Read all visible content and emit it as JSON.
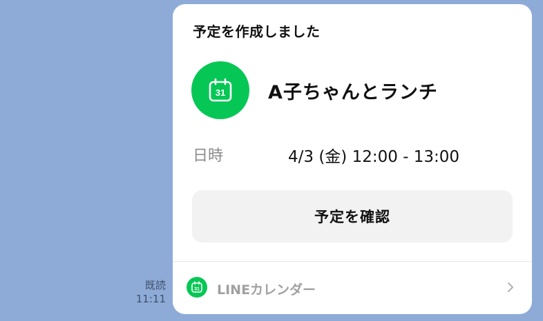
{
  "message": {
    "read_label": "既読",
    "time": "11:11"
  },
  "card": {
    "header": "予定を作成しました",
    "icon": {
      "name": "calendar-icon",
      "day": "31"
    },
    "event_title": "A子ちゃんとランチ",
    "datetime_label": "日時",
    "datetime_value": "4/3 (金) 12:00 - 13:00",
    "confirm_button": "予定を確認",
    "footer": {
      "icon": {
        "name": "line-calendar-icon",
        "day": "31"
      },
      "label": "LINEカレンダー",
      "chevron": "chevron-right-icon"
    }
  },
  "colors": {
    "chat_background": "#8eabd8",
    "accent_green": "#06c755",
    "card_background": "#ffffff",
    "button_background": "#f2f2f2"
  }
}
